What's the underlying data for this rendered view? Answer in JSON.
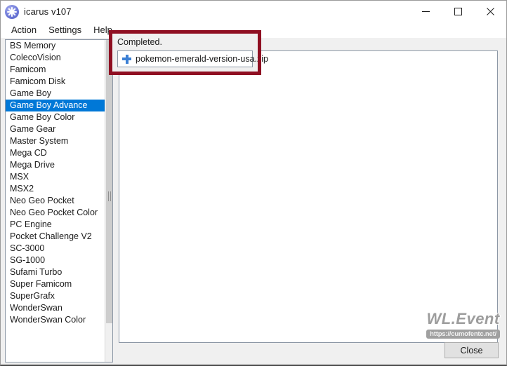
{
  "window": {
    "title": "icarus v107",
    "icon": "snowflake-icon",
    "controls": {
      "minimize": "minimize-icon",
      "maximize": "maximize-icon",
      "close": "close-icon"
    }
  },
  "menubar": {
    "items": [
      {
        "label": "Action"
      },
      {
        "label": "Settings"
      },
      {
        "label": "Help"
      }
    ]
  },
  "sidebar": {
    "selected": "Game Boy Advance",
    "items": [
      {
        "label": "BS Memory"
      },
      {
        "label": "ColecoVision"
      },
      {
        "label": "Famicom"
      },
      {
        "label": "Famicom Disk"
      },
      {
        "label": "Game Boy"
      },
      {
        "label": "Game Boy Advance"
      },
      {
        "label": "Game Boy Color"
      },
      {
        "label": "Game Gear"
      },
      {
        "label": "Master System"
      },
      {
        "label": "Mega CD"
      },
      {
        "label": "Mega Drive"
      },
      {
        "label": "MSX"
      },
      {
        "label": "MSX2"
      },
      {
        "label": "Neo Geo Pocket"
      },
      {
        "label": "Neo Geo Pocket Color"
      },
      {
        "label": "PC Engine"
      },
      {
        "label": "Pocket Challenge V2"
      },
      {
        "label": "SC-3000"
      },
      {
        "label": "SG-1000"
      },
      {
        "label": "Sufami Turbo"
      },
      {
        "label": "Super Famicom"
      },
      {
        "label": "SuperGrafx"
      },
      {
        "label": "WonderSwan"
      },
      {
        "label": "WonderSwan Color"
      }
    ]
  },
  "completed_popup": {
    "status_label": "Completed.",
    "file_icon": "plus-icon",
    "file_name": "pokemon-emerald-version-usa.zip",
    "highlight_color": "#8f0f22"
  },
  "watermark": {
    "title": "WL.Event",
    "url": "https://cumofentc.net/"
  },
  "footer": {
    "close_label": "Close"
  },
  "colors": {
    "accent": "#0078d7",
    "annotation": "#8f0f22",
    "chrome": "#f0f0f0"
  }
}
